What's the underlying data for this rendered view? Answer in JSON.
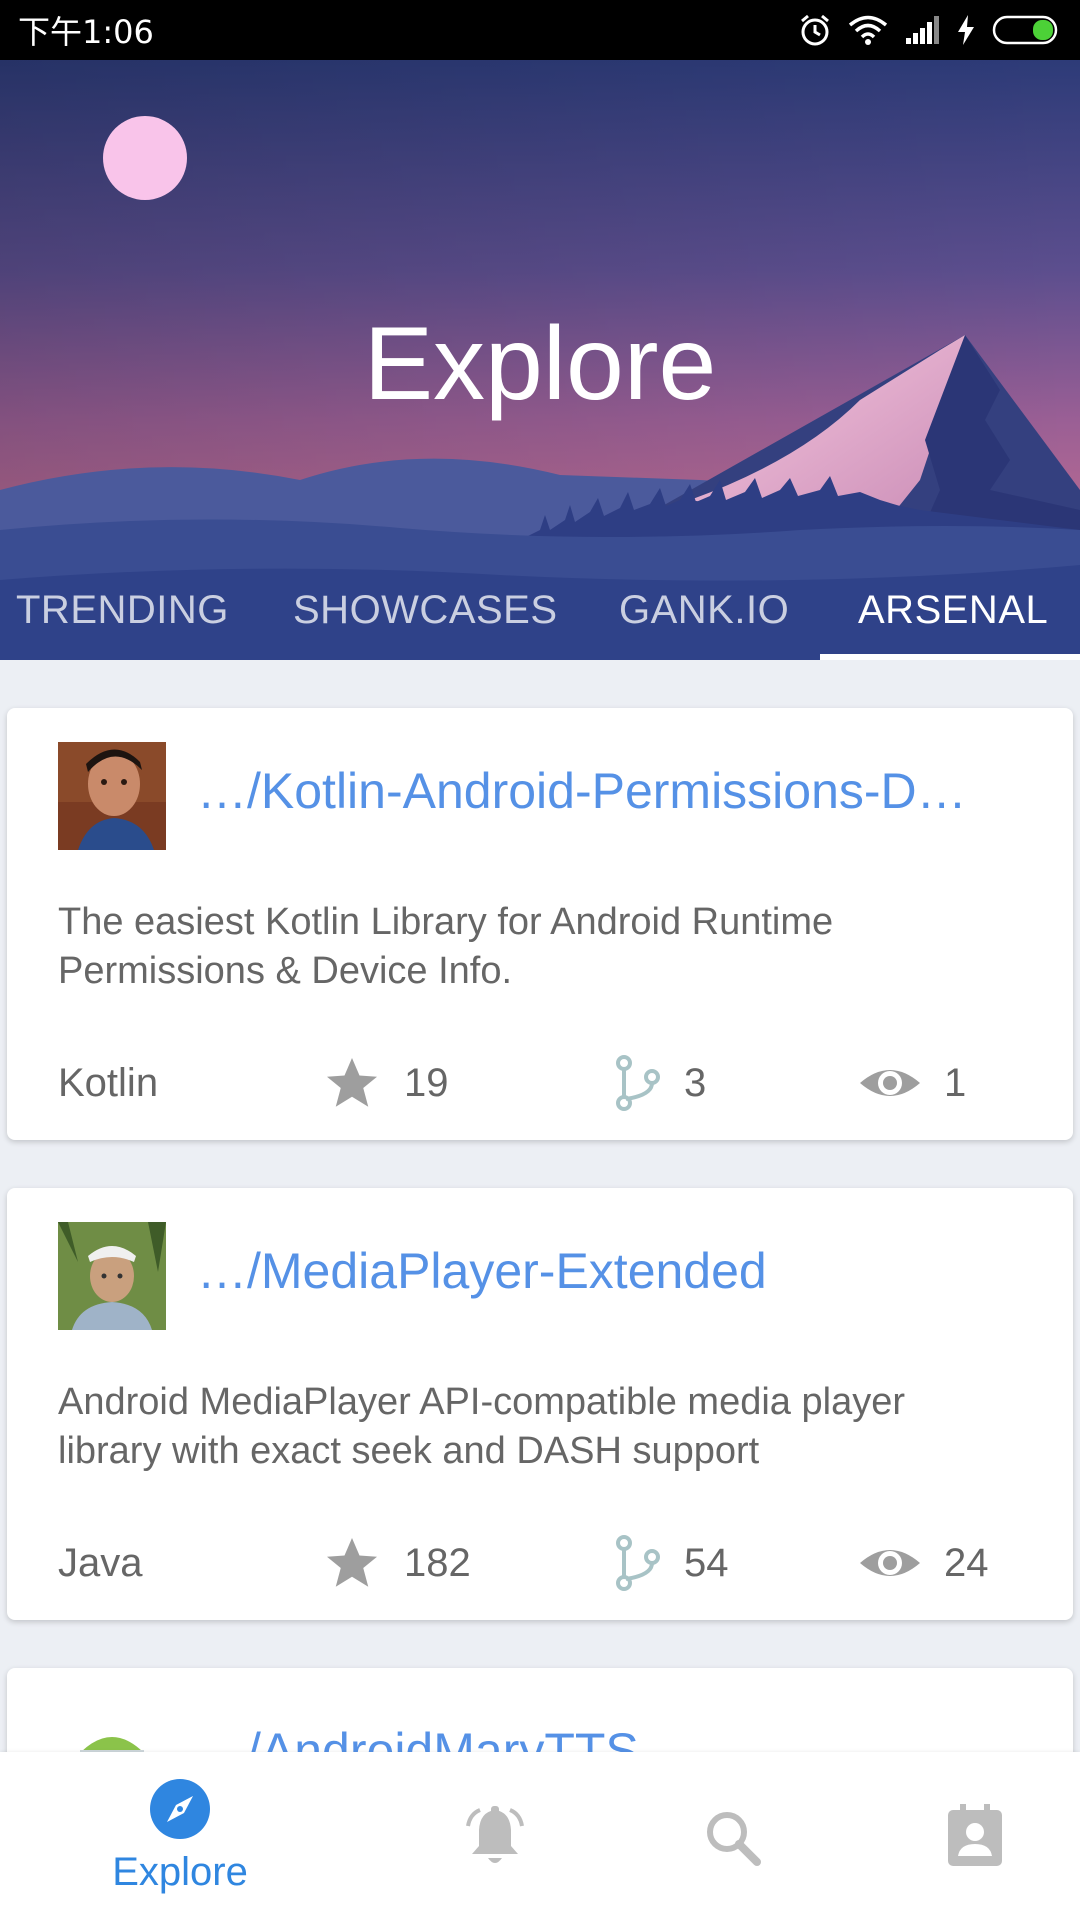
{
  "status_bar": {
    "time": "下午1:06",
    "icons": [
      "alarm-icon",
      "wifi-icon",
      "signal-icon",
      "charging-icon",
      "battery-icon"
    ]
  },
  "header": {
    "title": "Explore",
    "tabs": [
      {
        "label": "TRENDING",
        "active": false
      },
      {
        "label": "SHOWCASES",
        "active": false
      },
      {
        "label": "GANK.IO",
        "active": false
      },
      {
        "label": "ARSENAL",
        "active": true
      }
    ]
  },
  "repos": [
    {
      "title": "…/Kotlin-Android-Permissions-D…",
      "description": "The easiest Kotlin Library for Android Runtime Permissions & Device Info.",
      "language": "Kotlin",
      "stars": "19",
      "forks": "3",
      "watchers": "1"
    },
    {
      "title": "…/MediaPlayer-Extended",
      "description": "Android MediaPlayer API-compatible media player library with exact seek and DASH support",
      "language": "Java",
      "stars": "182",
      "forks": "54",
      "watchers": "24"
    },
    {
      "title": "…/AndroidMaryTTS"
    }
  ],
  "bottom_nav": {
    "items": [
      {
        "label": "Explore",
        "icon": "compass-icon",
        "active": true
      },
      {
        "icon": "notification-bell-icon",
        "active": false
      },
      {
        "icon": "search-icon",
        "active": false
      },
      {
        "icon": "contacts-icon",
        "active": false
      }
    ]
  },
  "colors": {
    "accent": "#5591e6",
    "nav_active": "#2f86e0",
    "icon_gray": "#bdbdbd",
    "status_bar": "#000000"
  }
}
